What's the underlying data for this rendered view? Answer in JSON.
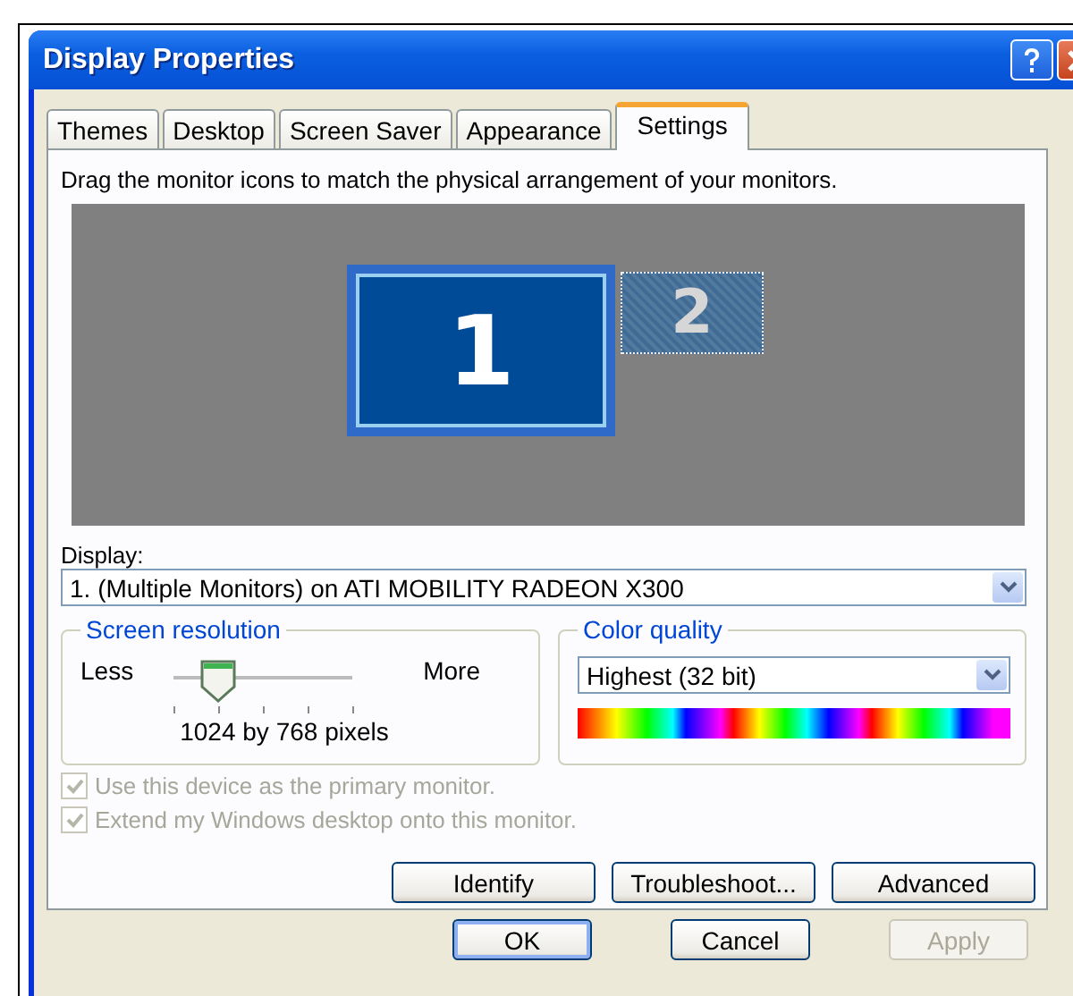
{
  "window": {
    "title": "Display Properties"
  },
  "tabs": [
    {
      "label": "Themes",
      "selected": false
    },
    {
      "label": "Desktop",
      "selected": false
    },
    {
      "label": "Screen Saver",
      "selected": false
    },
    {
      "label": "Appearance",
      "selected": false
    },
    {
      "label": "Settings",
      "selected": true
    }
  ],
  "instruction": "Drag the monitor icons to match the physical arrangement of your monitors.",
  "monitors": [
    {
      "label": "1",
      "selected": true
    },
    {
      "label": "2",
      "selected": false
    }
  ],
  "display": {
    "label": "Display:",
    "value": "1. (Multiple Monitors) on ATI MOBILITY RADEON X300"
  },
  "screen_resolution": {
    "title": "Screen resolution",
    "min_label": "Less",
    "max_label": "More",
    "level": 0.25,
    "reading": "1024 by 768 pixels"
  },
  "color_quality": {
    "title": "Color quality",
    "value": "Highest (32 bit)"
  },
  "options": [
    {
      "label": "Use this device as the primary monitor.",
      "checked": true,
      "disabled": true
    },
    {
      "label": "Extend my Windows desktop onto this monitor.",
      "checked": true,
      "disabled": true
    }
  ],
  "panel_buttons": [
    {
      "label": "Identify",
      "disabled": false
    },
    {
      "label": "Troubleshoot...",
      "disabled": false
    },
    {
      "label": "Advanced",
      "disabled": false
    }
  ],
  "dialog_buttons": [
    {
      "label": "OK",
      "disabled": false,
      "default": true
    },
    {
      "label": "Cancel",
      "disabled": false,
      "default": false
    },
    {
      "label": "Apply",
      "disabled": true,
      "default": false
    }
  ]
}
